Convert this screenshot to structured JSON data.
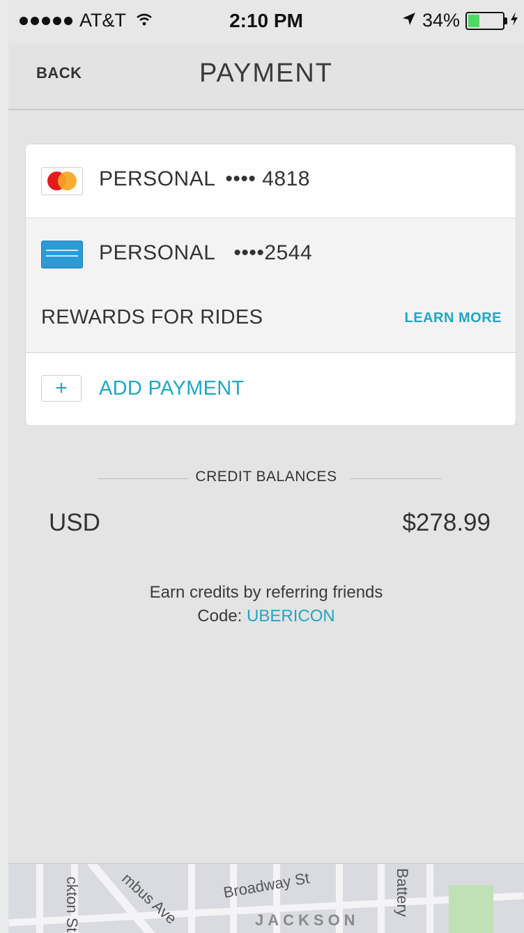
{
  "status_bar": {
    "carrier": "AT&T",
    "time": "2:10 PM",
    "battery": "34%",
    "battery_level": 0.34
  },
  "nav": {
    "back_label": "BACK",
    "title": "PAYMENT"
  },
  "payment_methods": [
    {
      "label": "PERSONAL",
      "mask": "•••• 4818",
      "icon": "mastercard-icon"
    },
    {
      "label": "PERSONAL",
      "mask": "••••2544",
      "icon": "amex-icon"
    }
  ],
  "rewards": {
    "label": "REWARDS FOR RIDES",
    "link": "LEARN MORE"
  },
  "add_payment": {
    "icon": "+",
    "label": "ADD PAYMENT"
  },
  "credit": {
    "heading": "CREDIT BALANCES",
    "currency": "USD",
    "amount": "$278.99"
  },
  "referral": {
    "text": "Earn credits by referring friends",
    "code_label": "Code:",
    "code": "UBERICON"
  },
  "map": {
    "street_1": "ckton St",
    "street_2": "mbus Ave",
    "street_3": "Broadway St",
    "street_4": "Battery",
    "district": "JACKSON"
  },
  "colors": {
    "accent": "#1fa7c4",
    "battery": "#4cd964"
  }
}
